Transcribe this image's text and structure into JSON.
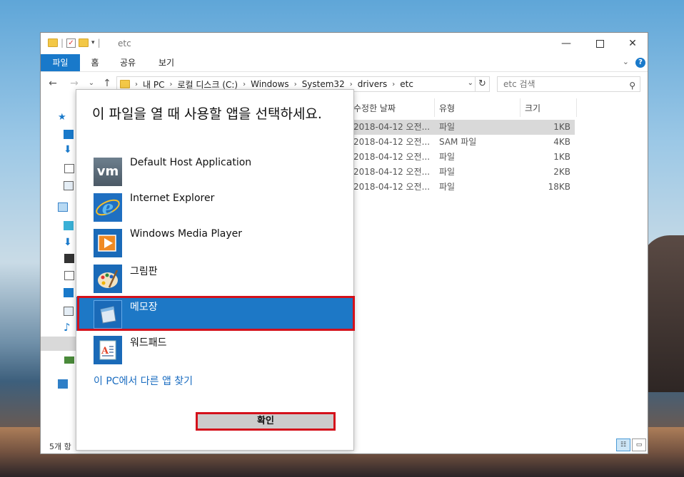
{
  "window": {
    "title": "etc",
    "ribbon_tabs": [
      "파일",
      "홈",
      "공유",
      "보기"
    ],
    "help": "?"
  },
  "address": {
    "crumbs": [
      "내 PC",
      "로컬 디스크 (C:)",
      "Windows",
      "System32",
      "drivers",
      "etc"
    ],
    "search_placeholder": "etc 검색"
  },
  "columns": [
    "수정한 날짜",
    "유형",
    "크기"
  ],
  "files": [
    {
      "date": "2018-04-12 오전...",
      "type": "파일",
      "size": "1KB"
    },
    {
      "date": "2018-04-12 오전...",
      "type": "SAM 파일",
      "size": "4KB"
    },
    {
      "date": "2018-04-12 오전...",
      "type": "파일",
      "size": "1KB"
    },
    {
      "date": "2018-04-12 오전...",
      "type": "파일",
      "size": "2KB"
    },
    {
      "date": "2018-04-12 오전...",
      "type": "파일",
      "size": "18KB"
    }
  ],
  "status": {
    "item_count": "5개 항"
  },
  "dialog": {
    "title": "이 파일을 열 때 사용할 앱을 선택하세요.",
    "apps": [
      {
        "name": "Default Host Application",
        "icon": "vmware-icon",
        "icon_text": "vm"
      },
      {
        "name": "Internet Explorer",
        "icon": "internet-explorer-icon"
      },
      {
        "name": "Windows Media Player",
        "icon": "media-player-icon"
      },
      {
        "name": "그림판",
        "icon": "paint-icon"
      },
      {
        "name": "메모장",
        "icon": "notepad-icon"
      },
      {
        "name": "워드패드",
        "icon": "wordpad-icon"
      }
    ],
    "selected_app": "메모장",
    "more_apps_link": "이 PC에서 다른 앱 찾기",
    "ok_button": "확인"
  },
  "colors": {
    "accent": "#1979ca",
    "selection": "#1d78c6",
    "highlight_outline": "#d4111b",
    "link": "#1a6cc0"
  }
}
